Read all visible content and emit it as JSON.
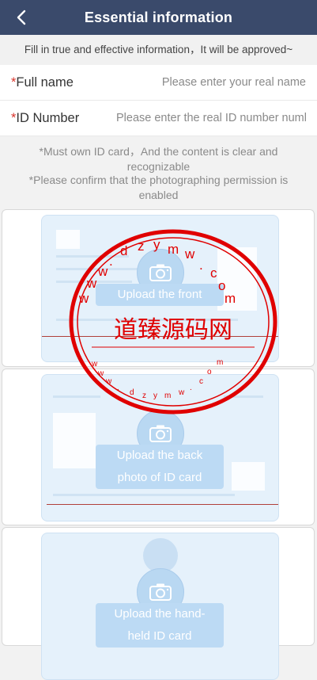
{
  "header": {
    "title": "Essential information",
    "back_icon": "chevron-left-icon",
    "bg_color": "#3a4a6b"
  },
  "notice": "Fill in true and effective information，It will be approved~",
  "form": {
    "full_name": {
      "required_mark": "*",
      "label": "Full name",
      "placeholder": "Please enter your real name",
      "value": ""
    },
    "id_number": {
      "required_mark": "*",
      "label": "ID Number",
      "placeholder": "Please enter the real ID number number",
      "value": ""
    }
  },
  "hints": {
    "line1": "*Must own ID card，And the content is clear and recognizable",
    "line2": "*Please confirm that the photographing permission is enabled"
  },
  "uploads": {
    "front": {
      "label": "Upload the front",
      "icon": "camera-icon"
    },
    "back": {
      "label1": "Upload the back",
      "label2": "photo of ID card",
      "icon": "camera-icon"
    },
    "handheld": {
      "label1": "Upload the hand-",
      "label2": "held ID card",
      "icon": "camera-icon"
    }
  },
  "watermark": {
    "site": "www.dzymw.com",
    "text": "道臻源码网",
    "color": "#e00000"
  }
}
